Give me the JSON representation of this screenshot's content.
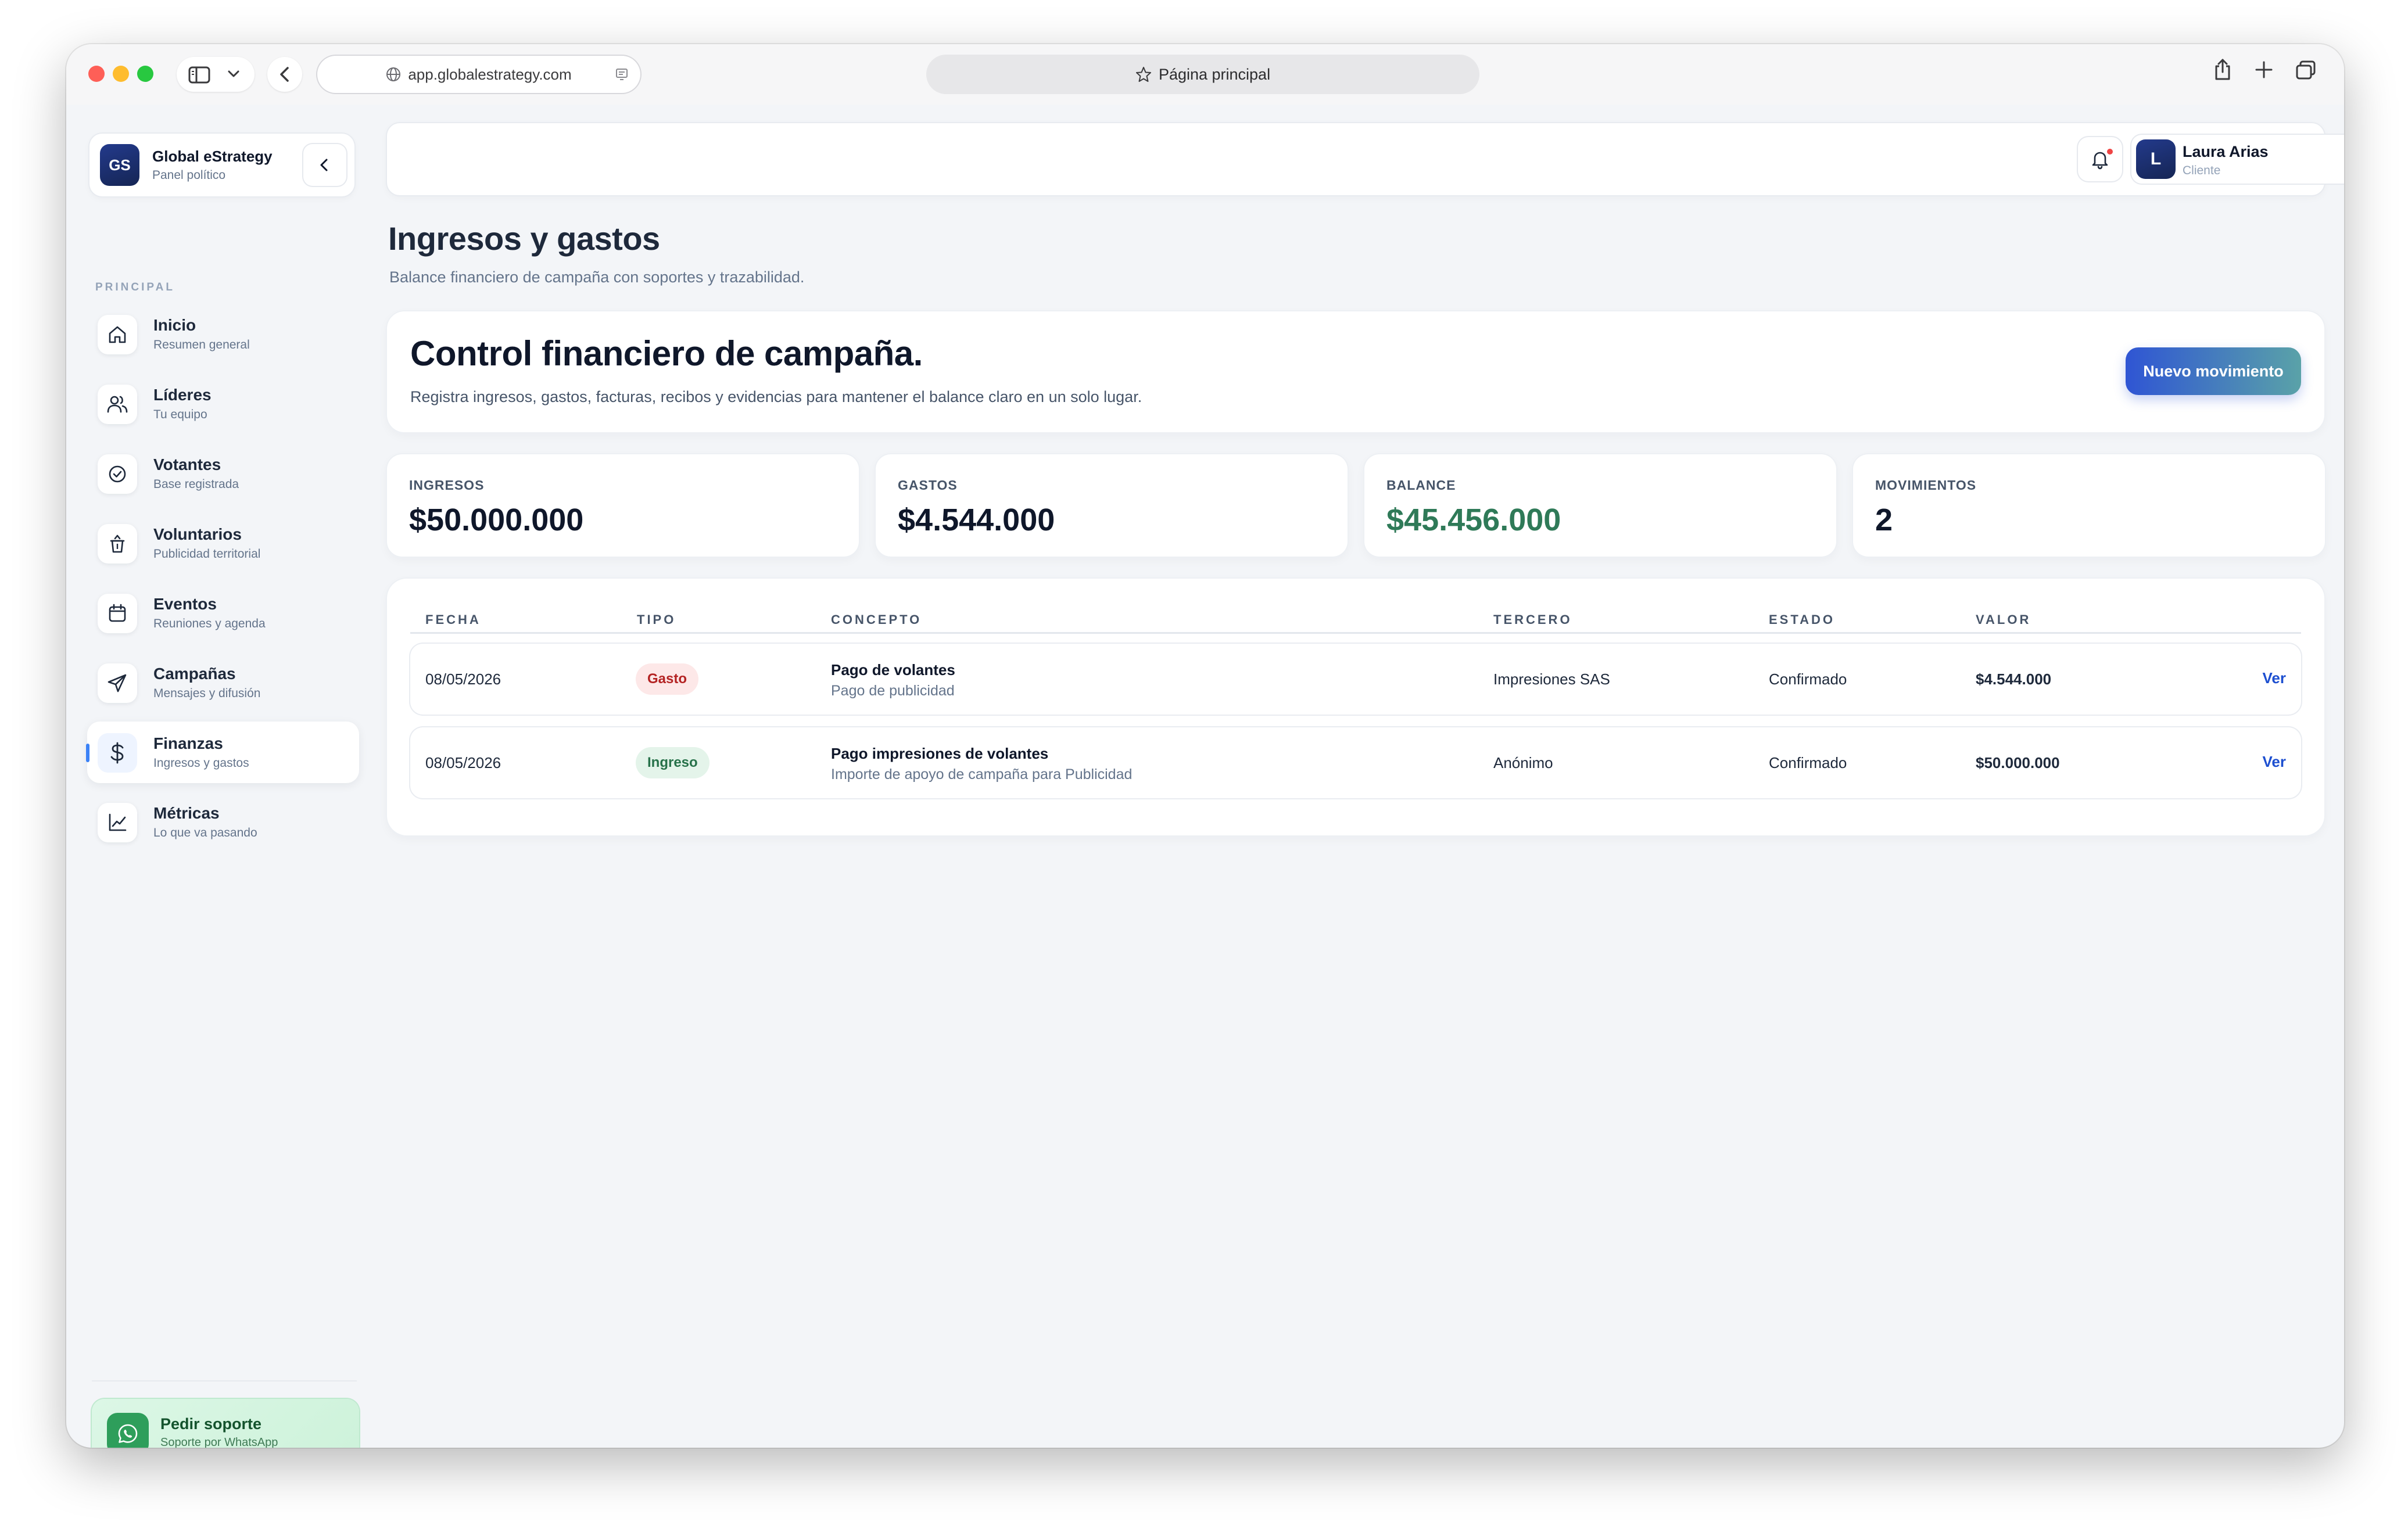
{
  "browser": {
    "url": "app.globalestrategy.com",
    "tab_title": "Página principal"
  },
  "brand": {
    "initials": "GS",
    "name": "Global eStrategy",
    "subtitle": "Panel político"
  },
  "sidebar": {
    "section_label": "PRINCIPAL",
    "items": [
      {
        "title": "Inicio",
        "subtitle": "Resumen general",
        "icon": "home-icon"
      },
      {
        "title": "Líderes",
        "subtitle": "Tu equipo",
        "icon": "users-icon"
      },
      {
        "title": "Votantes",
        "subtitle": "Base registrada",
        "icon": "check-circle-icon"
      },
      {
        "title": "Voluntarios",
        "subtitle": "Publicidad territorial",
        "icon": "trash-icon"
      },
      {
        "title": "Eventos",
        "subtitle": "Reuniones y agenda",
        "icon": "calendar-icon"
      },
      {
        "title": "Campañas",
        "subtitle": "Mensajes y difusión",
        "icon": "send-icon"
      },
      {
        "title": "Finanzas",
        "subtitle": "Ingresos y gastos",
        "icon": "dollar-icon",
        "active": true
      },
      {
        "title": "Métricas",
        "subtitle": "Lo que va pasando",
        "icon": "chart-line-icon"
      }
    ],
    "support": {
      "title": "Pedir soporte",
      "subtitle": "Soporte por WhatsApp"
    }
  },
  "user": {
    "initial": "L",
    "name": "Laura Arias",
    "role": "Cliente"
  },
  "page": {
    "title": "Ingresos y gastos",
    "subtitle": "Balance financiero de campaña con soportes y trazabilidad."
  },
  "hero": {
    "title": "Control financiero de campaña.",
    "text": "Registra ingresos, gastos, facturas, recibos y evidencias para mantener el balance claro en un solo lugar.",
    "button": "Nuevo movimiento"
  },
  "stats": [
    {
      "label": "INGRESOS",
      "value": "$50.000.000"
    },
    {
      "label": "GASTOS",
      "value": "$4.544.000"
    },
    {
      "label": "BALANCE",
      "value": "$45.456.000"
    },
    {
      "label": "MOVIMIENTOS",
      "value": "2"
    }
  ],
  "table": {
    "headers": [
      "FECHA",
      "TIPO",
      "CONCEPTO",
      "TERCERO",
      "ESTADO",
      "VALOR"
    ],
    "rows": [
      {
        "fecha": "08/05/2026",
        "tipo": "Gasto",
        "concepto": "Pago de volantes",
        "concepto_detalle": "Pago de publicidad",
        "tercero": "Impresiones SAS",
        "estado": "Confirmado",
        "valor": "$4.544.000",
        "accion": "Ver"
      },
      {
        "fecha": "08/05/2026",
        "tipo": "Ingreso",
        "concepto": "Pago impresiones de volantes",
        "concepto_detalle": "Importe de apoyo de campaña para Publicidad",
        "tercero": "Anónimo",
        "estado": "Confirmado",
        "valor": "$50.000.000",
        "accion": "Ver"
      }
    ]
  },
  "colors": {
    "accent": "#2f55d4",
    "balance_green": "#2f7a58",
    "gasto_badge": "#b42323",
    "ingreso_badge": "#27724a",
    "link": "#1d4fd0"
  }
}
